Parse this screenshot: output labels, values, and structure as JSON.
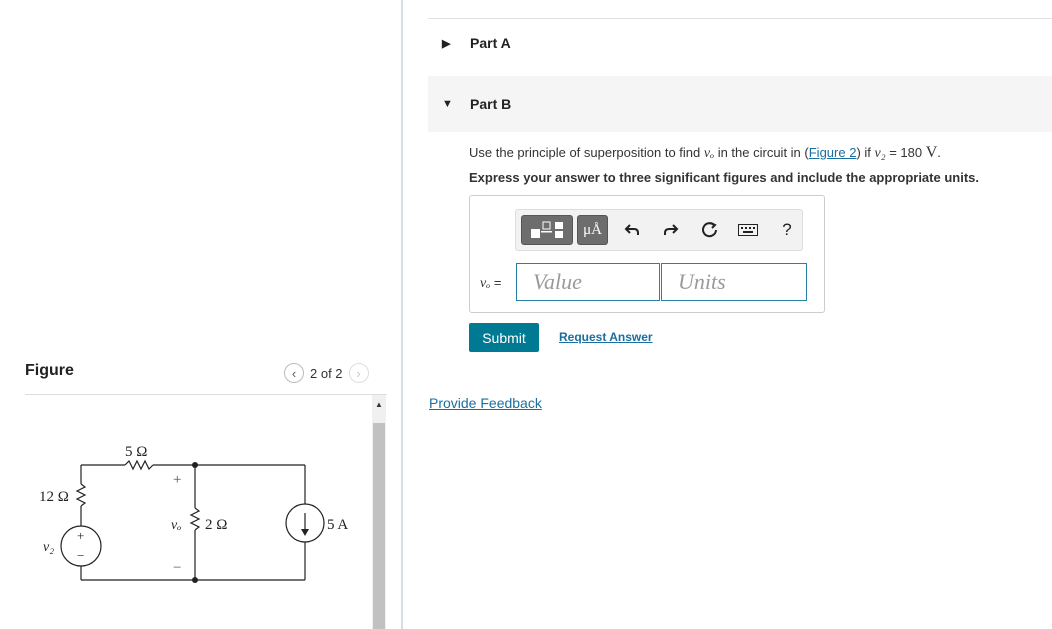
{
  "figure_panel": {
    "title": "Figure",
    "pager": "2 of 2",
    "circuit": {
      "r1": "5 Ω",
      "r2": "12 Ω",
      "r3": "2 Ω",
      "source_v": "v₂",
      "source_i": "5 A",
      "vo_label": "vₒ",
      "plus": "+",
      "minus": "−"
    }
  },
  "parts": {
    "a_label": "Part A",
    "b_label": "Part B"
  },
  "question": {
    "pre": "Use the principle of superposition to find ",
    "var": "vₒ",
    "mid": " in the circuit in (",
    "link": "Figure 2",
    "post": ") if ",
    "var2": "v₂",
    "eq": " = 180 ",
    "unit": "V",
    "end": ".",
    "instructions": "Express your answer to three significant figures and include the appropriate units."
  },
  "answer": {
    "label_var": "vₒ",
    "label_eq": " =",
    "value_placeholder": "Value",
    "units_placeholder": "Units",
    "toolbar": {
      "units_glyph": "μÅ",
      "help": "?"
    }
  },
  "actions": {
    "submit": "Submit",
    "request": "Request Answer",
    "feedback": "Provide Feedback"
  }
}
